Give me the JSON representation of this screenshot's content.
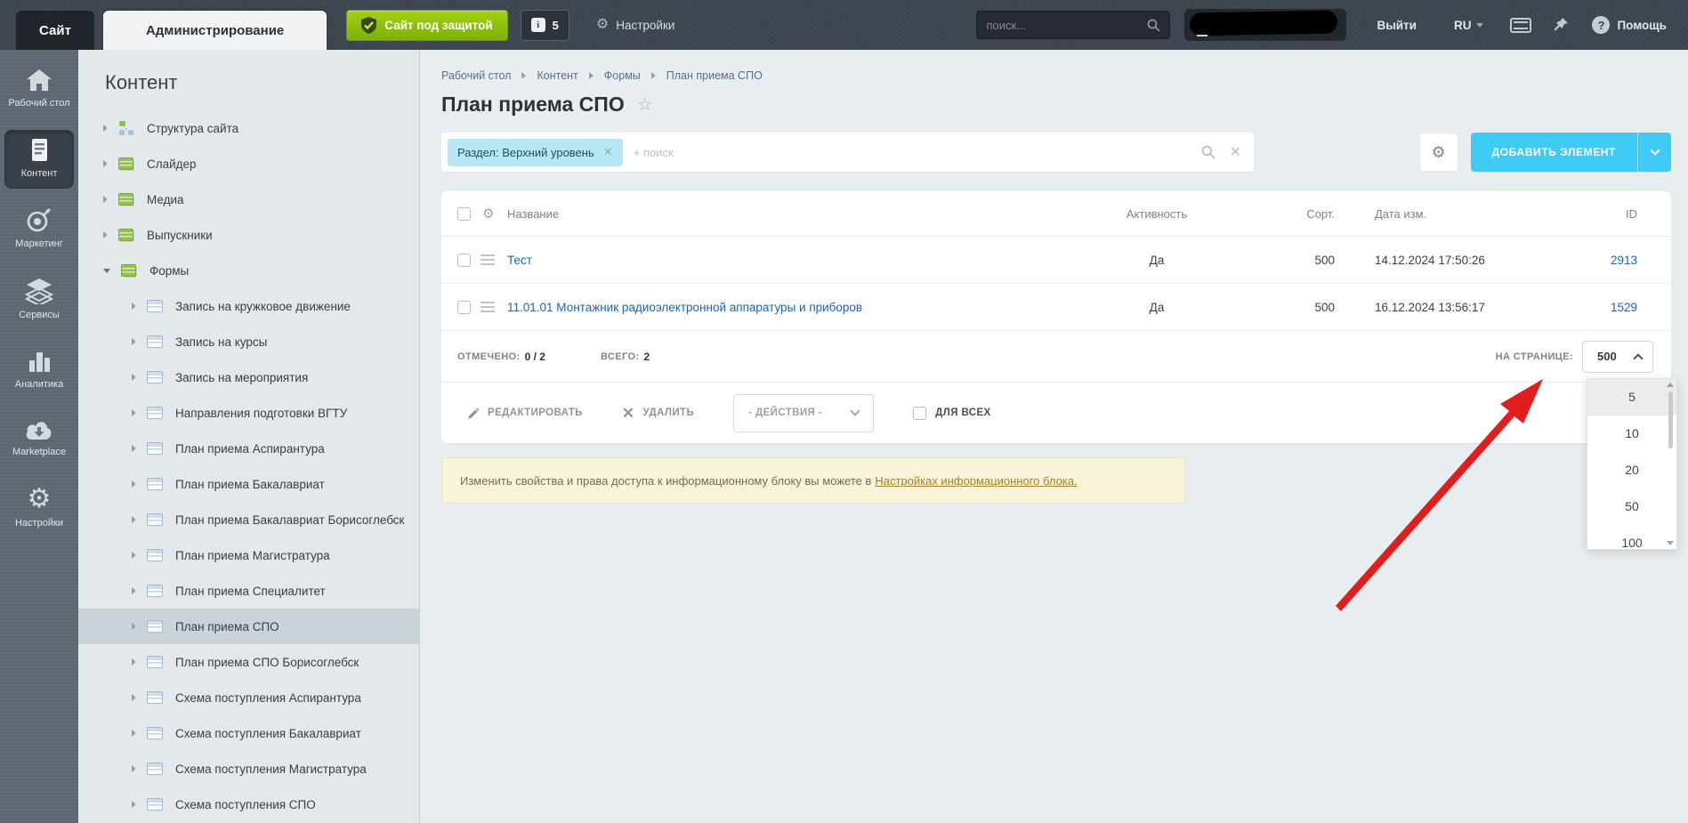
{
  "topbar": {
    "site_tab": "Сайт",
    "admin_tab": "Администрирование",
    "protection": "Сайт под защитой",
    "notifications": "5",
    "notif_icon": "i",
    "settings": "Настройки",
    "search_placeholder": "поиск...",
    "logout": "Выйти",
    "lang": "RU",
    "help": "Помощь",
    "help_icon": "?"
  },
  "nav": {
    "items": [
      {
        "label": "Рабочий стол",
        "icon": "home-icon",
        "active": false
      },
      {
        "label": "Контент",
        "icon": "content-icon",
        "active": true
      },
      {
        "label": "Маркетинг",
        "icon": "target-icon",
        "active": false
      },
      {
        "label": "Сервисы",
        "icon": "layers-icon",
        "active": false
      },
      {
        "label": "Аналитика",
        "icon": "bar-chart-icon",
        "active": false
      },
      {
        "label": "Marketplace",
        "icon": "cloud-download-icon",
        "active": false
      },
      {
        "label": "Настройки",
        "icon": "gear-icon",
        "active": false
      }
    ]
  },
  "tree": {
    "title": "Контент",
    "items": [
      {
        "label": "Структура сайта",
        "level": 0
      },
      {
        "label": "Слайдер",
        "level": 0
      },
      {
        "label": "Медиа",
        "level": 0
      },
      {
        "label": "Выпускники",
        "level": 0
      },
      {
        "label": "Формы",
        "level": 0,
        "expanded": true
      },
      {
        "label": "Запись на кружковое движение",
        "level": 1
      },
      {
        "label": "Запись на курсы",
        "level": 1
      },
      {
        "label": "Запись на мероприятия",
        "level": 1
      },
      {
        "label": "Направления подготовки ВГТУ",
        "level": 1
      },
      {
        "label": "План приема Аспирантура",
        "level": 1
      },
      {
        "label": "План приема Бакалавриат",
        "level": 1
      },
      {
        "label": "План приема Бакалавриат Борисоглебск",
        "level": 1
      },
      {
        "label": "План приема Магистратура",
        "level": 1
      },
      {
        "label": "План приема Специалитет",
        "level": 1
      },
      {
        "label": "План приема СПО",
        "level": 1,
        "selected": true
      },
      {
        "label": "План приема СПО Борисоглебск",
        "level": 1
      },
      {
        "label": "Схема поступления Аспирантура",
        "level": 1
      },
      {
        "label": "Схема поступления Бакалавриат",
        "level": 1
      },
      {
        "label": "Схема поступления Магистратура",
        "level": 1
      },
      {
        "label": "Схема поступления СПО",
        "level": 1
      }
    ]
  },
  "breadcrumb": {
    "items": [
      "Рабочий стол",
      "Контент",
      "Формы",
      "План приема СПО"
    ]
  },
  "page": {
    "title": "План приема СПО"
  },
  "filter": {
    "chip": "Раздел: Верхний уровень",
    "placeholder": "+ поиск"
  },
  "toolbar": {
    "add_button": "ДОБАВИТЬ ЭЛЕМЕНТ"
  },
  "table": {
    "col_name": "Название",
    "col_active": "Активность",
    "col_sort": "Сорт.",
    "col_modified": "Дата изм.",
    "col_id": "ID",
    "rows": [
      {
        "name": "Тест",
        "active": "Да",
        "sort": "500",
        "modified": "14.12.2024 17:50:26",
        "id": "2913"
      },
      {
        "name": "11.01.01 Монтажник радиоэлектронной аппаратуры и приборов",
        "active": "Да",
        "sort": "500",
        "modified": "16.12.2024 13:56:17",
        "id": "1529"
      }
    ]
  },
  "footer": {
    "checked_label": "ОТМЕЧЕНО:",
    "checked_value": "0 / 2",
    "total_label": "ВСЕГО:",
    "total_value": "2",
    "per_page_label": "НА СТРАНИЦЕ:",
    "per_page_value": "500",
    "per_page_options": [
      "5",
      "10",
      "20",
      "50",
      "100"
    ]
  },
  "actions": {
    "edit": "РЕДАКТИРОВАТЬ",
    "remove": "УДАЛИТЬ",
    "menu": "- ДЕЙСТВИЯ -",
    "for_all": "ДЛЯ ВСЕХ"
  },
  "notice": {
    "text": "Изменить свойства и права доступа к информационному блоку вы можете в",
    "link": "Настройках информационного блока."
  },
  "colors": {
    "accent_blue": "#3fcbf5",
    "link_blue": "#1f63ae",
    "protect_green": "#86b915",
    "chip_blue": "#b7e7f4",
    "notice_bg": "#f9f3da",
    "arrow_red": "#e11d1d",
    "selected_row": "#ccd3d8"
  }
}
